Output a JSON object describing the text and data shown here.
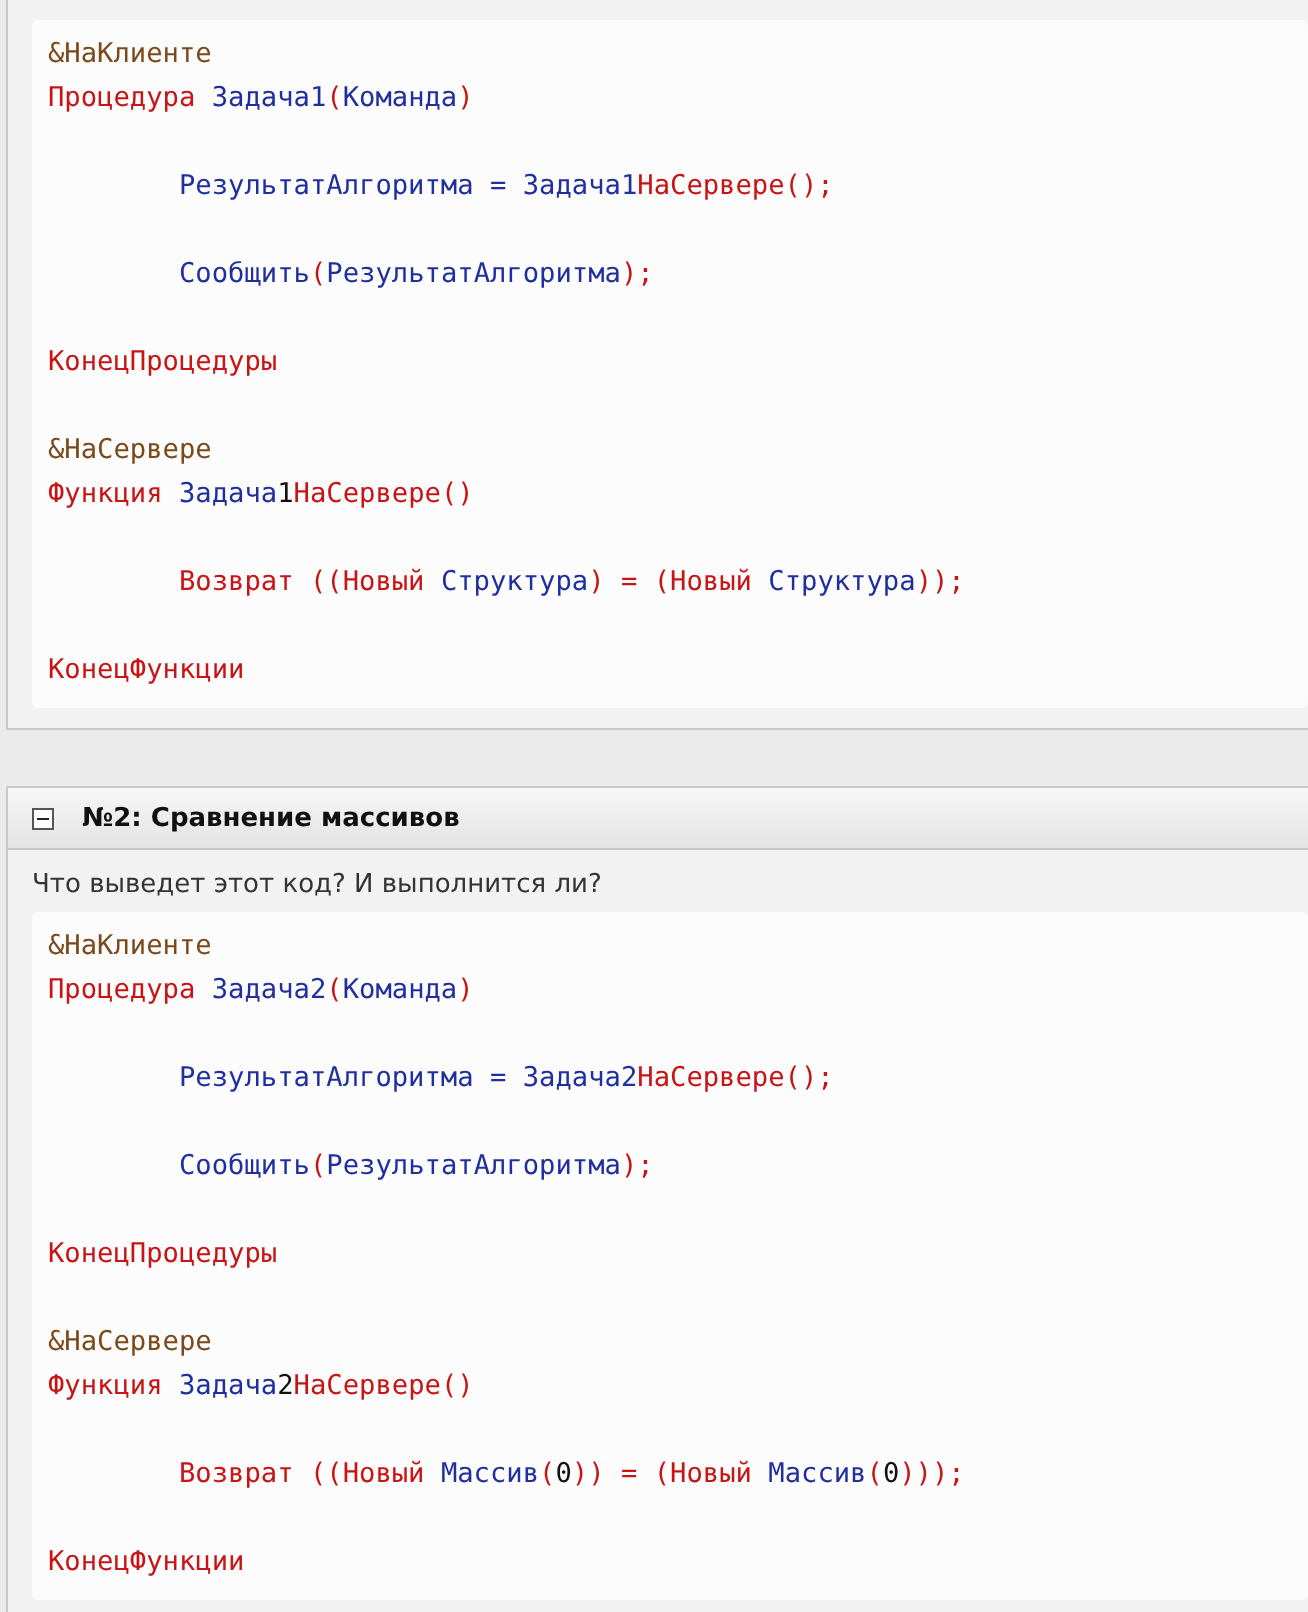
{
  "sections": [
    {
      "code": [
        {
          "lines": [
            [
              {
                "text": "&НаКлиенте",
                "kind": "directive"
              }
            ],
            [
              {
                "text": "Процедура ",
                "kind": "keyword"
              },
              {
                "text": "Задача1",
                "kind": "identifier"
              },
              {
                "text": "(",
                "kind": "keyword"
              },
              {
                "text": "Команда",
                "kind": "identifier"
              },
              {
                "text": ")",
                "kind": "keyword"
              }
            ]
          ]
        },
        {
          "lines": [
            [
              {
                "text": "\tРезультатАлгоритма = Задача1",
                "kind": "identifier"
              },
              {
                "text": "НаСервере();",
                "kind": "keyword"
              }
            ]
          ]
        },
        {
          "lines": [
            [
              {
                "text": "\tСообщить",
                "kind": "identifier"
              },
              {
                "text": "(",
                "kind": "keyword"
              },
              {
                "text": "РезультатАлгоритма",
                "kind": "identifier"
              },
              {
                "text": ");",
                "kind": "keyword"
              }
            ]
          ]
        },
        {
          "lines": [
            [
              {
                "text": "КонецПроцедуры",
                "kind": "keyword"
              }
            ]
          ]
        },
        {
          "lines": [
            [
              {
                "text": "&НаСервере",
                "kind": "directive"
              }
            ],
            [
              {
                "text": "Функция ",
                "kind": "keyword"
              },
              {
                "text": "Задача",
                "kind": "identifier"
              },
              {
                "text": "1",
                "kind": "number"
              },
              {
                "text": "НаСервере()",
                "kind": "keyword"
              }
            ]
          ]
        },
        {
          "lines": [
            [
              {
                "text": "\tВозврат ((Новый ",
                "kind": "keyword"
              },
              {
                "text": "Структура",
                "kind": "identifier"
              },
              {
                "text": ") = (Новый ",
                "kind": "keyword"
              },
              {
                "text": "Структура",
                "kind": "identifier"
              },
              {
                "text": "));",
                "kind": "keyword"
              }
            ]
          ]
        },
        {
          "lines": [
            [
              {
                "text": "КонецФункции",
                "kind": "keyword"
              }
            ]
          ]
        }
      ]
    },
    {
      "title": "№2: Сравнение массивов",
      "expanded": true,
      "question": "Что выведет этот код? И выполнится ли?",
      "code": [
        {
          "lines": [
            [
              {
                "text": "&НаКлиенте",
                "kind": "directive"
              }
            ],
            [
              {
                "text": "Процедура ",
                "kind": "keyword"
              },
              {
                "text": "Задача2",
                "kind": "identifier"
              },
              {
                "text": "(",
                "kind": "keyword"
              },
              {
                "text": "Команда",
                "kind": "identifier"
              },
              {
                "text": ")",
                "kind": "keyword"
              }
            ]
          ]
        },
        {
          "lines": [
            [
              {
                "text": "\tРезультатАлгоритма = Задача2",
                "kind": "identifier"
              },
              {
                "text": "НаСервере();",
                "kind": "keyword"
              }
            ]
          ]
        },
        {
          "lines": [
            [
              {
                "text": "\tСообщить",
                "kind": "identifier"
              },
              {
                "text": "(",
                "kind": "keyword"
              },
              {
                "text": "РезультатАлгоритма",
                "kind": "identifier"
              },
              {
                "text": ");",
                "kind": "keyword"
              }
            ]
          ]
        },
        {
          "lines": [
            [
              {
                "text": "КонецПроцедуры",
                "kind": "keyword"
              }
            ]
          ]
        },
        {
          "lines": [
            [
              {
                "text": "&НаСервере",
                "kind": "directive"
              }
            ],
            [
              {
                "text": "Функция ",
                "kind": "keyword"
              },
              {
                "text": "Задача",
                "kind": "identifier"
              },
              {
                "text": "2",
                "kind": "number"
              },
              {
                "text": "НаСервере()",
                "kind": "keyword"
              }
            ]
          ]
        },
        {
          "lines": [
            [
              {
                "text": "\tВозврат ((Новый ",
                "kind": "keyword"
              },
              {
                "text": "Массив",
                "kind": "identifier"
              },
              {
                "text": "(",
                "kind": "keyword"
              },
              {
                "text": "0",
                "kind": "number"
              },
              {
                "text": ")) = (Новый ",
                "kind": "keyword"
              },
              {
                "text": "Массив",
                "kind": "identifier"
              },
              {
                "text": "(",
                "kind": "keyword"
              },
              {
                "text": "0",
                "kind": "number"
              },
              {
                "text": ")));",
                "kind": "keyword"
              }
            ]
          ]
        },
        {
          "lines": [
            [
              {
                "text": "КонецФункции",
                "kind": "keyword"
              }
            ]
          ]
        }
      ]
    }
  ]
}
